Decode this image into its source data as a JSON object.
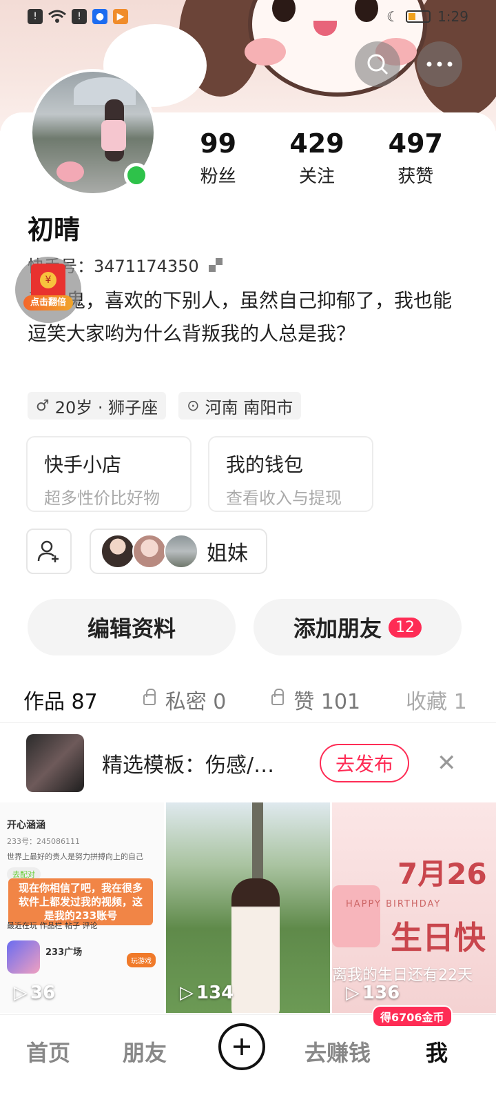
{
  "status_bar": {
    "time": "1:29",
    "left_icons": [
      "alert-icon",
      "wifi-icon",
      "alert-icon",
      "app-blue-icon",
      "app-orange-icon"
    ],
    "right_icons": [
      "moon-icon",
      "battery-icon"
    ]
  },
  "header": {
    "search_icon": "search-icon",
    "more_icon": "more-icon"
  },
  "profile": {
    "name": "初晴",
    "kuaishou_id": "快手号：3471174350",
    "bio": "爱哭鬼，喜欢的下别人，虽然自己抑郁了，我也能逗笑大家哟为什么背叛我的人总是我？",
    "online": true
  },
  "stats": [
    {
      "value": "99",
      "label": "粉丝"
    },
    {
      "value": "429",
      "label": "关注"
    },
    {
      "value": "497",
      "label": "获赞"
    }
  ],
  "red_packet": {
    "label": "点击翻倍"
  },
  "chips": [
    {
      "icon": "gender-icon",
      "text": "20岁 · 狮子座"
    },
    {
      "icon": "location-icon",
      "text": "河南 南阳市"
    }
  ],
  "services": [
    {
      "title": "快手小店",
      "subtitle": "超多性价比好物"
    },
    {
      "title": "我的钱包",
      "subtitle": "查看收入与提现"
    }
  ],
  "friends": {
    "group_label": "姐妹"
  },
  "actions": {
    "edit": "编辑资料",
    "add_friends": "添加朋友",
    "add_friends_badge": "12"
  },
  "tabs": [
    {
      "label": "作品 87",
      "locked": false,
      "active": true
    },
    {
      "label": "私密 0",
      "locked": true,
      "active": false
    },
    {
      "label": "赞 101",
      "locked": true,
      "active": false
    },
    {
      "label": "收藏 1",
      "locked": false,
      "active": false
    }
  ],
  "template_banner": {
    "text": "精选模板：伤感/…",
    "publish": "去发布"
  },
  "videos": [
    {
      "plays": "36",
      "user": "开心涵涵",
      "id_line": "233号：245086111",
      "motto": "世界上最好的贵人是努力拼搏向上的自己",
      "pair": "去配对",
      "overlay": "现在你相信了吧，我在很多软件上都发过我的视频，这是我的233账号",
      "tabs_line": "最近在玩  作品栏  帖子  评论",
      "game": "233广场",
      "game_btn": "玩游戏"
    },
    {
      "plays": "134"
    },
    {
      "plays": "136",
      "title": "7月26",
      "subtitle": "HAPPY BIRTHDAY",
      "title2": "生日快",
      "caption": "离我的生日还有22天"
    }
  ],
  "bottom_nav": {
    "home": "首页",
    "friends": "朋友",
    "earn": "去赚钱",
    "me": "我",
    "coin_badge": "得6706金币"
  }
}
